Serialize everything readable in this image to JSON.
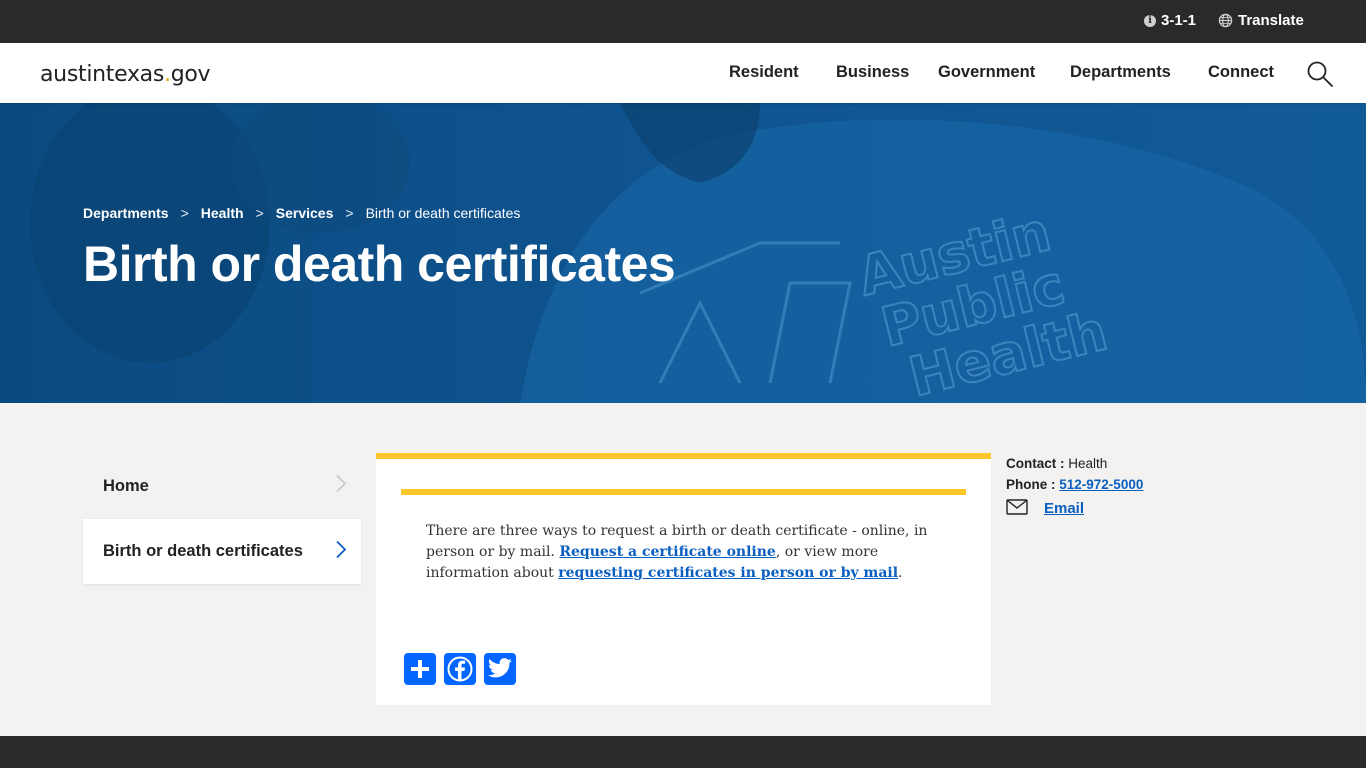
{
  "topbar": {
    "phone_label": "3-1-1",
    "translate_label": "Translate"
  },
  "header": {
    "brand_main": "austintexas",
    "brand_dot": ".",
    "brand_tld": "gov",
    "brand_dot_color": "#e1a800",
    "nav": [
      "Resident",
      "Business",
      "Government",
      "Departments",
      "Connect"
    ]
  },
  "hero": {
    "breadcrumb": [
      "Departments",
      "Health",
      "Services",
      "Birth or death certificates"
    ],
    "breadcrumb_sep": ">",
    "title": "Birth or death certificates",
    "background_color": "#0e4e86"
  },
  "sidebar": {
    "items": [
      {
        "label": "Home",
        "active": false
      },
      {
        "label": "Birth or death certificates",
        "active": true
      }
    ]
  },
  "content": {
    "accent_color": "#fcc72d",
    "para_start": "There are three ways to request a birth or death certificate - online, in person or by mail. ",
    "link1": "Request a certificate online",
    "para_mid": ", or view more information about ",
    "link2": "requesting certificates in person or by mail",
    "para_end": ".",
    "share_icons": [
      "share-plus-icon",
      "facebook-icon",
      "twitter-icon"
    ]
  },
  "contact": {
    "contact_label": "Contact :",
    "contact_value": "Health",
    "phone_label": "Phone :",
    "phone_value": "512-972-5000",
    "email_label": "Email"
  },
  "colors": {
    "link": "#0b5fc1",
    "dark_bar": "#2a2a2a",
    "share_blue": "#0166ff"
  }
}
